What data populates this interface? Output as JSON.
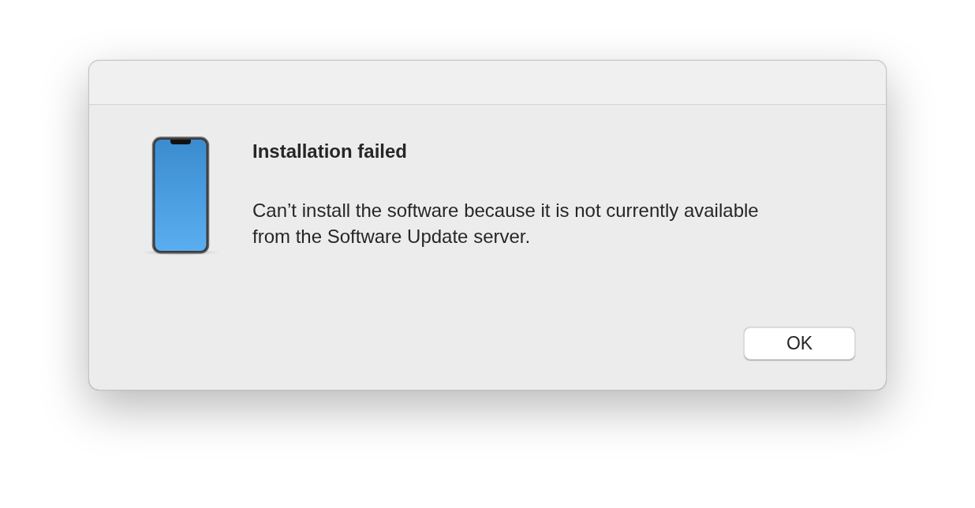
{
  "dialog": {
    "title": "Installation failed",
    "message": "Can’t install the software because it is not currently available from the Software Update server.",
    "buttons": [
      "OK"
    ]
  }
}
